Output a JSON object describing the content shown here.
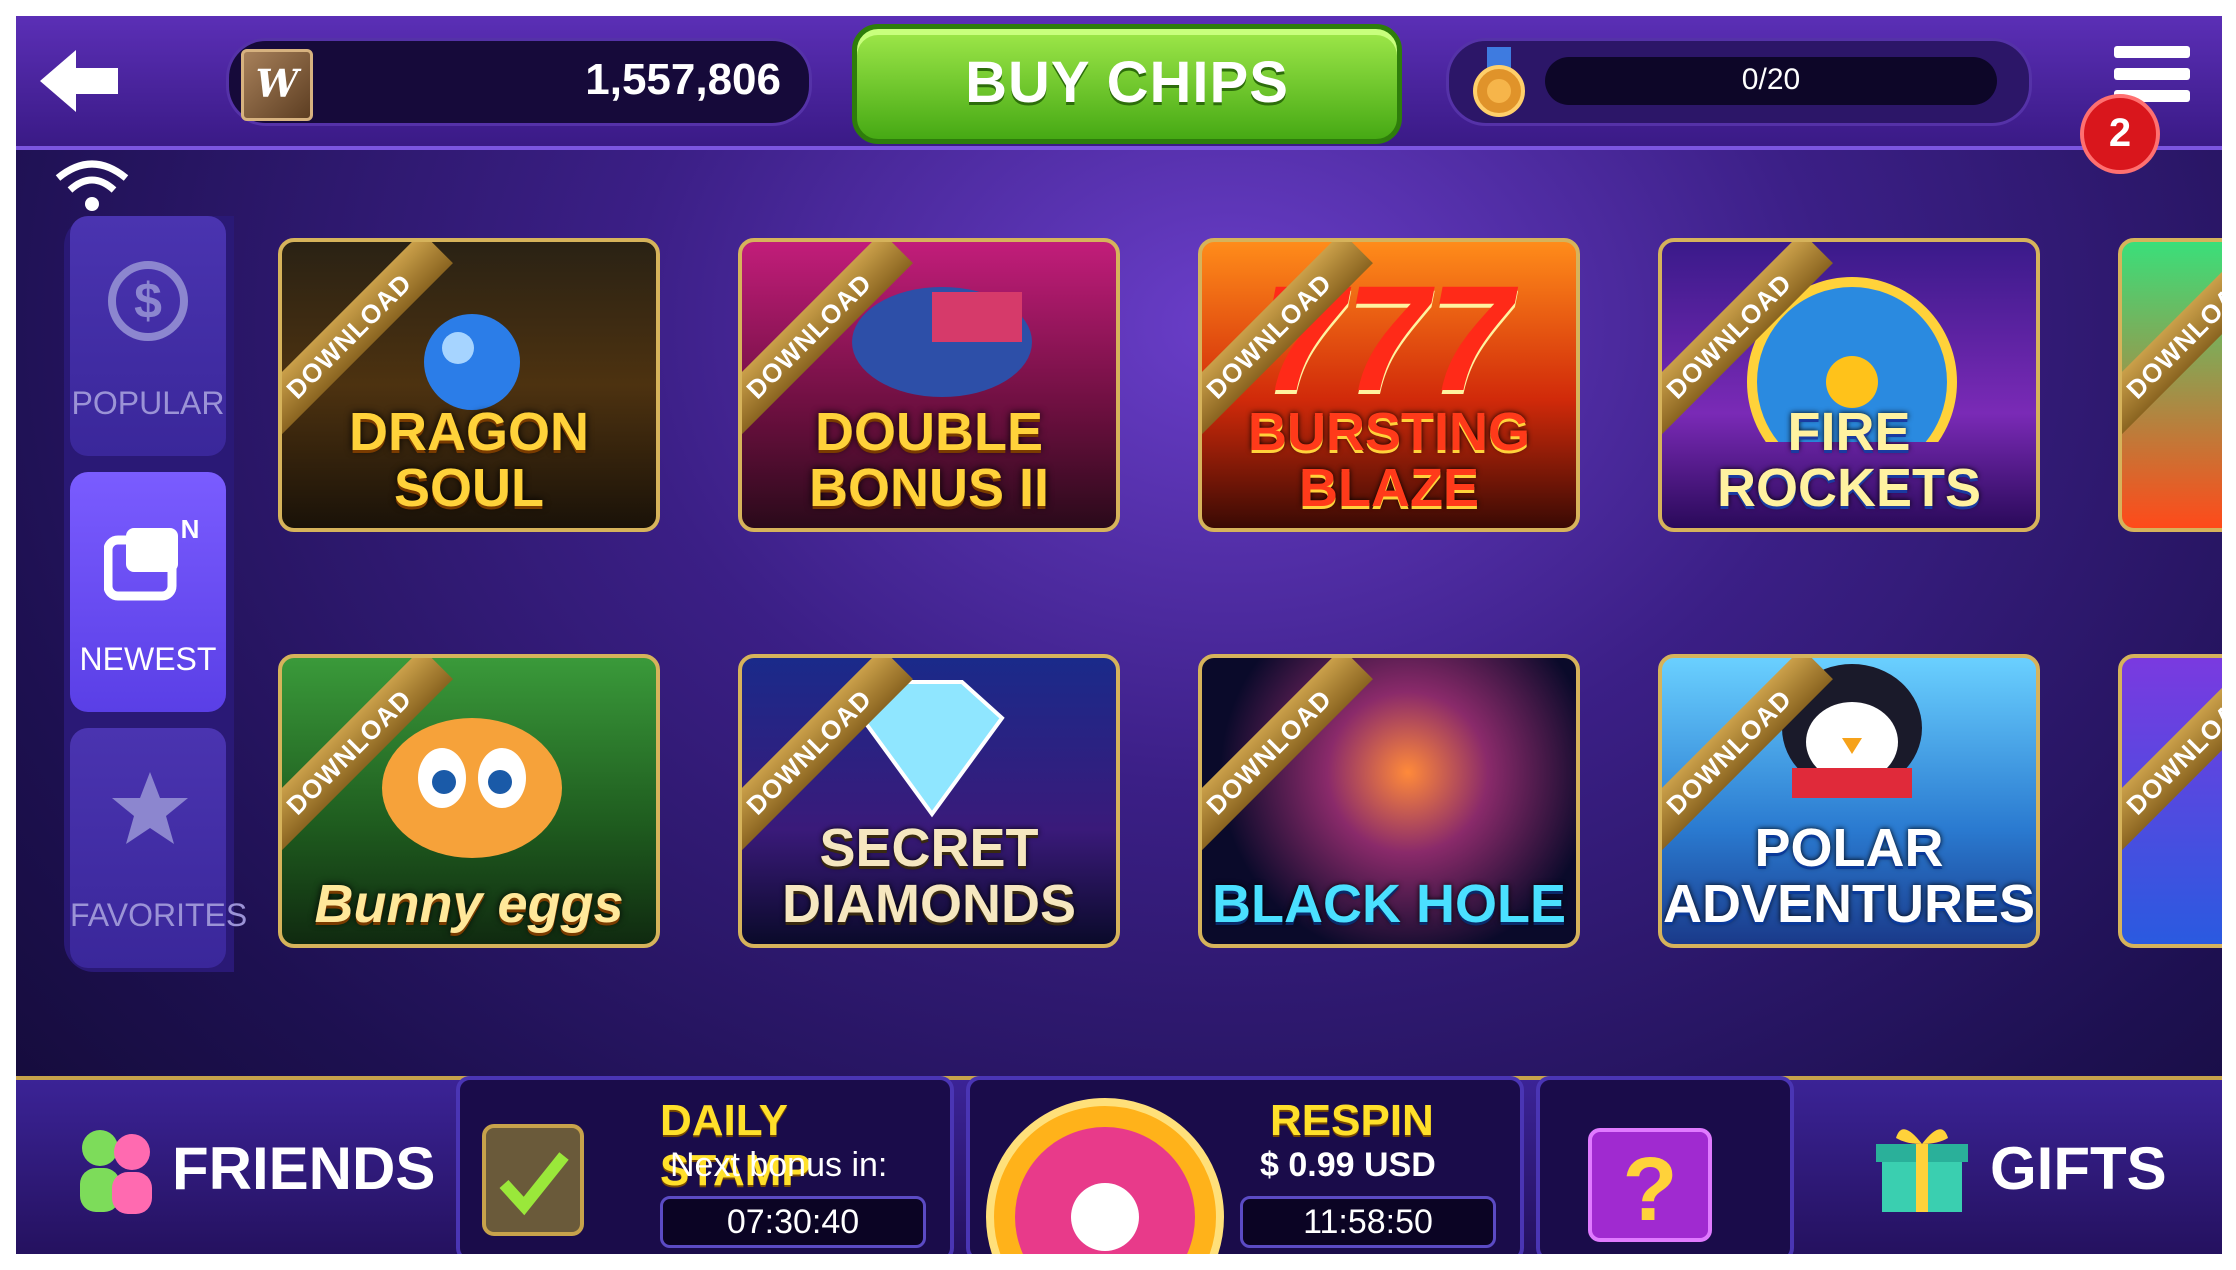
{
  "topbar": {
    "chip_logo": "W",
    "chips": "1,557,806",
    "buy_label": "BUY CHIPS",
    "level_progress": "0/20",
    "notifications": "2"
  },
  "sidebar": {
    "items": [
      {
        "label": "POPULAR"
      },
      {
        "label": "NEWEST"
      },
      {
        "label": "FAVORITES"
      }
    ]
  },
  "games": {
    "ribbon": "DOWNLOAD",
    "tiles": [
      {
        "title": "DRAGON SOUL"
      },
      {
        "title": "DOUBLE BONUS II"
      },
      {
        "title": "BURSTING BLAZE"
      },
      {
        "title": "FIRE ROCKETS"
      },
      {
        "title": "Bunny eggs"
      },
      {
        "title": "SECRET DIAMONDS"
      },
      {
        "title": "BLACK HOLE"
      },
      {
        "title": "POLAR ADVENTURES"
      }
    ]
  },
  "bottom": {
    "friends": "FRIENDS",
    "gifts": "GIFTS",
    "daily_stamp": {
      "title": "DAILY STAMP",
      "subtitle": "Next bonus in:",
      "timer": "07:30:40"
    },
    "respin": {
      "title": "RESPIN",
      "price": "$ 0.99 USD",
      "timer": "11:58:50"
    }
  },
  "colors": {
    "buy_green": "#46a914",
    "accent_purple": "#5a3fe6",
    "gold": "#ffd23a"
  }
}
